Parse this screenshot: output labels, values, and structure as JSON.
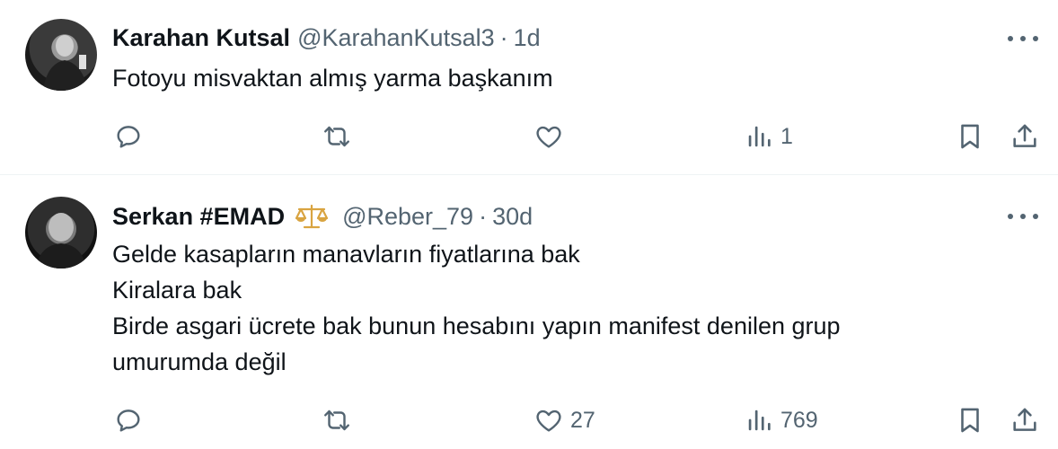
{
  "tweets": [
    {
      "name": "Karahan Kutsal",
      "handle": "@KarahanKutsal3",
      "separator": "·",
      "time": "1d",
      "text_lines": [
        "Fotoyu misvaktan almış yarma başkanım"
      ],
      "stats": {
        "replies": "",
        "retweets": "",
        "likes": "",
        "views": "1"
      }
    },
    {
      "name": "Serkan #EMAD",
      "badge_icon": "scales-icon",
      "handle": "@Reber_79",
      "separator": "·",
      "time": "30d",
      "text_lines": [
        "Gelde kasapların manavların fiyatlarına bak",
        "Kiralara bak",
        "Birde asgari ücrete bak bunun hesabını yapın manifest denilen grup",
        "umurumda değil"
      ],
      "stats": {
        "replies": "",
        "retweets": "",
        "likes": "27",
        "views": "769"
      }
    }
  ],
  "colors": {
    "text": "#0f1419",
    "secondary": "#536471",
    "divider": "#eff3f4",
    "badge": "#d9a441"
  }
}
